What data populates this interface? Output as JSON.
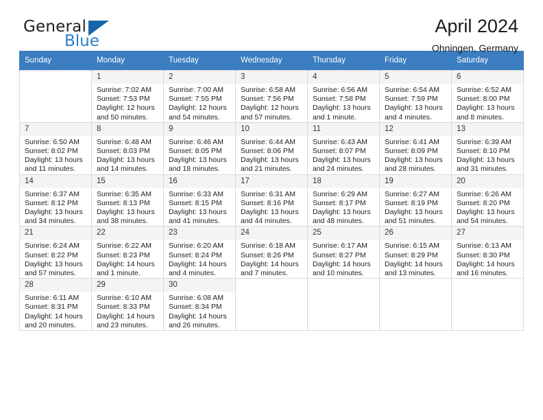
{
  "brand": {
    "name_top": "General",
    "name_bottom": "Blue",
    "triangle_color": "#1566a8",
    "blue_color": "#2a7fc9"
  },
  "header": {
    "title": "April 2024",
    "subtitle": "Ohningen, Germany"
  },
  "calendar": {
    "header_bg": "#3b7dc0",
    "daynum_bg": "#f4f4f4",
    "weekdays": [
      "Sunday",
      "Monday",
      "Tuesday",
      "Wednesday",
      "Thursday",
      "Friday",
      "Saturday"
    ],
    "weeks": [
      [
        {
          "empty": true
        },
        {
          "day": "1",
          "sunrise": "Sunrise: 7:02 AM",
          "sunset": "Sunset: 7:53 PM",
          "daylight": "Daylight: 12 hours and 50 minutes."
        },
        {
          "day": "2",
          "sunrise": "Sunrise: 7:00 AM",
          "sunset": "Sunset: 7:55 PM",
          "daylight": "Daylight: 12 hours and 54 minutes."
        },
        {
          "day": "3",
          "sunrise": "Sunrise: 6:58 AM",
          "sunset": "Sunset: 7:56 PM",
          "daylight": "Daylight: 12 hours and 57 minutes."
        },
        {
          "day": "4",
          "sunrise": "Sunrise: 6:56 AM",
          "sunset": "Sunset: 7:58 PM",
          "daylight": "Daylight: 13 hours and 1 minute."
        },
        {
          "day": "5",
          "sunrise": "Sunrise: 6:54 AM",
          "sunset": "Sunset: 7:59 PM",
          "daylight": "Daylight: 13 hours and 4 minutes."
        },
        {
          "day": "6",
          "sunrise": "Sunrise: 6:52 AM",
          "sunset": "Sunset: 8:00 PM",
          "daylight": "Daylight: 13 hours and 8 minutes."
        }
      ],
      [
        {
          "day": "7",
          "sunrise": "Sunrise: 6:50 AM",
          "sunset": "Sunset: 8:02 PM",
          "daylight": "Daylight: 13 hours and 11 minutes."
        },
        {
          "day": "8",
          "sunrise": "Sunrise: 6:48 AM",
          "sunset": "Sunset: 8:03 PM",
          "daylight": "Daylight: 13 hours and 14 minutes."
        },
        {
          "day": "9",
          "sunrise": "Sunrise: 6:46 AM",
          "sunset": "Sunset: 8:05 PM",
          "daylight": "Daylight: 13 hours and 18 minutes."
        },
        {
          "day": "10",
          "sunrise": "Sunrise: 6:44 AM",
          "sunset": "Sunset: 8:06 PM",
          "daylight": "Daylight: 13 hours and 21 minutes."
        },
        {
          "day": "11",
          "sunrise": "Sunrise: 6:43 AM",
          "sunset": "Sunset: 8:07 PM",
          "daylight": "Daylight: 13 hours and 24 minutes."
        },
        {
          "day": "12",
          "sunrise": "Sunrise: 6:41 AM",
          "sunset": "Sunset: 8:09 PM",
          "daylight": "Daylight: 13 hours and 28 minutes."
        },
        {
          "day": "13",
          "sunrise": "Sunrise: 6:39 AM",
          "sunset": "Sunset: 8:10 PM",
          "daylight": "Daylight: 13 hours and 31 minutes."
        }
      ],
      [
        {
          "day": "14",
          "sunrise": "Sunrise: 6:37 AM",
          "sunset": "Sunset: 8:12 PM",
          "daylight": "Daylight: 13 hours and 34 minutes."
        },
        {
          "day": "15",
          "sunrise": "Sunrise: 6:35 AM",
          "sunset": "Sunset: 8:13 PM",
          "daylight": "Daylight: 13 hours and 38 minutes."
        },
        {
          "day": "16",
          "sunrise": "Sunrise: 6:33 AM",
          "sunset": "Sunset: 8:15 PM",
          "daylight": "Daylight: 13 hours and 41 minutes."
        },
        {
          "day": "17",
          "sunrise": "Sunrise: 6:31 AM",
          "sunset": "Sunset: 8:16 PM",
          "daylight": "Daylight: 13 hours and 44 minutes."
        },
        {
          "day": "18",
          "sunrise": "Sunrise: 6:29 AM",
          "sunset": "Sunset: 8:17 PM",
          "daylight": "Daylight: 13 hours and 48 minutes."
        },
        {
          "day": "19",
          "sunrise": "Sunrise: 6:27 AM",
          "sunset": "Sunset: 8:19 PM",
          "daylight": "Daylight: 13 hours and 51 minutes."
        },
        {
          "day": "20",
          "sunrise": "Sunrise: 6:26 AM",
          "sunset": "Sunset: 8:20 PM",
          "daylight": "Daylight: 13 hours and 54 minutes."
        }
      ],
      [
        {
          "day": "21",
          "sunrise": "Sunrise: 6:24 AM",
          "sunset": "Sunset: 8:22 PM",
          "daylight": "Daylight: 13 hours and 57 minutes."
        },
        {
          "day": "22",
          "sunrise": "Sunrise: 6:22 AM",
          "sunset": "Sunset: 8:23 PM",
          "daylight": "Daylight: 14 hours and 1 minute."
        },
        {
          "day": "23",
          "sunrise": "Sunrise: 6:20 AM",
          "sunset": "Sunset: 8:24 PM",
          "daylight": "Daylight: 14 hours and 4 minutes."
        },
        {
          "day": "24",
          "sunrise": "Sunrise: 6:18 AM",
          "sunset": "Sunset: 8:26 PM",
          "daylight": "Daylight: 14 hours and 7 minutes."
        },
        {
          "day": "25",
          "sunrise": "Sunrise: 6:17 AM",
          "sunset": "Sunset: 8:27 PM",
          "daylight": "Daylight: 14 hours and 10 minutes."
        },
        {
          "day": "26",
          "sunrise": "Sunrise: 6:15 AM",
          "sunset": "Sunset: 8:29 PM",
          "daylight": "Daylight: 14 hours and 13 minutes."
        },
        {
          "day": "27",
          "sunrise": "Sunrise: 6:13 AM",
          "sunset": "Sunset: 8:30 PM",
          "daylight": "Daylight: 14 hours and 16 minutes."
        }
      ],
      [
        {
          "day": "28",
          "sunrise": "Sunrise: 6:11 AM",
          "sunset": "Sunset: 8:31 PM",
          "daylight": "Daylight: 14 hours and 20 minutes."
        },
        {
          "day": "29",
          "sunrise": "Sunrise: 6:10 AM",
          "sunset": "Sunset: 8:33 PM",
          "daylight": "Daylight: 14 hours and 23 minutes."
        },
        {
          "day": "30",
          "sunrise": "Sunrise: 6:08 AM",
          "sunset": "Sunset: 8:34 PM",
          "daylight": "Daylight: 14 hours and 26 minutes."
        },
        {
          "empty": true
        },
        {
          "empty": true
        },
        {
          "empty": true
        },
        {
          "empty": true
        }
      ]
    ]
  }
}
